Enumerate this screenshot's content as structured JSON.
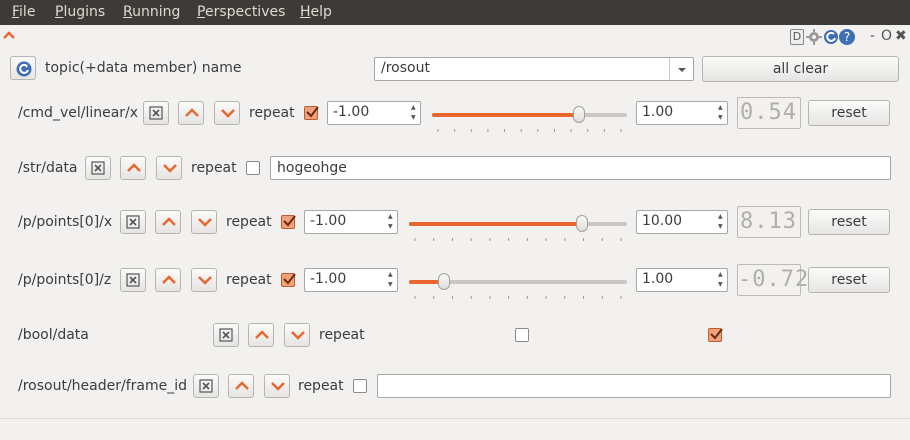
{
  "menu": [
    {
      "ul": "F",
      "rest": "ile"
    },
    {
      "ul": "P",
      "rest": "lugins"
    },
    {
      "ul": "R",
      "rest": "unning"
    },
    {
      "ul": "P",
      "rest": "erspectives"
    },
    {
      "ul": "H",
      "rest": "elp"
    }
  ],
  "window_controls": {
    "dc": "D",
    "float": "O",
    "close": "✖",
    "minimize": "-",
    "help": "?"
  },
  "header": {
    "topic_label": "topic(+data member) name",
    "topic_value": "/rosout",
    "all_clear_label": "all clear"
  },
  "rows": [
    {
      "name": "/cmd_vel/linear/x",
      "repeat_label": "repeat",
      "repeat_checked": true,
      "min": "-1.00",
      "max": "1.00",
      "slider_fraction": 0.77,
      "display": "0.54",
      "reset_label": "reset"
    },
    {
      "name": "/str/data",
      "repeat_label": "repeat",
      "repeat_checked": false,
      "text_value": "hogeohge"
    },
    {
      "name": "/p/points[0]/x",
      "repeat_label": "repeat",
      "repeat_checked": true,
      "min": "-1.00",
      "max": "10.00",
      "slider_fraction": 0.81,
      "display": "8.13",
      "reset_label": "reset"
    },
    {
      "name": "/p/points[0]/z",
      "repeat_label": "repeat",
      "repeat_checked": true,
      "min": "-1.00",
      "max": "1.00",
      "slider_fraction": 0.14,
      "display": "-0.72",
      "reset_label": "reset"
    },
    {
      "name": "/bool/data",
      "repeat_label": "repeat",
      "repeat_checked": false,
      "bool_checked": true
    },
    {
      "name": "/rosout/header/frame_id",
      "repeat_label": "repeat",
      "repeat_checked": false,
      "text_value": ""
    }
  ],
  "colors": {
    "accent": "#e9672f",
    "menubar": "#3c3b37",
    "background": "#f2f1f0"
  }
}
